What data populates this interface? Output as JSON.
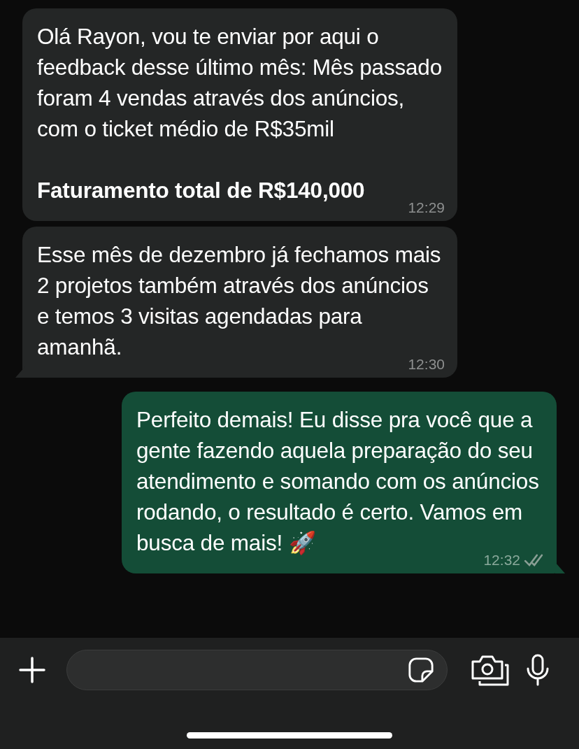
{
  "messages": [
    {
      "kind": "incoming",
      "tail": false,
      "paragraphs": [
        {
          "text": "Olá Rayon, vou te enviar por aqui o feedback desse último mês: Mês passado foram 4 vendas através dos anúncios, com o ticket médio de R$35mil",
          "bold": false
        },
        {
          "text": "Faturamento total de R$140,000",
          "bold": true
        }
      ],
      "time": "12:29"
    },
    {
      "kind": "incoming",
      "tail": true,
      "paragraphs": [
        {
          "text": "Esse mês de dezembro já fechamos mais 2 projetos também através dos anúncios e temos 3 visitas agendadas para amanhã.",
          "bold": false
        }
      ],
      "time": "12:30"
    },
    {
      "kind": "outgoing",
      "tail": true,
      "paragraphs": [
        {
          "text": "Perfeito demais! Eu disse pra você que a gente fazendo aquela preparação do seu atendimento e somando com os anúncios rodando, o resultado é certo. Vamos em busca de mais! 🚀",
          "bold": false
        }
      ],
      "time": "12:32",
      "read": false
    }
  ]
}
